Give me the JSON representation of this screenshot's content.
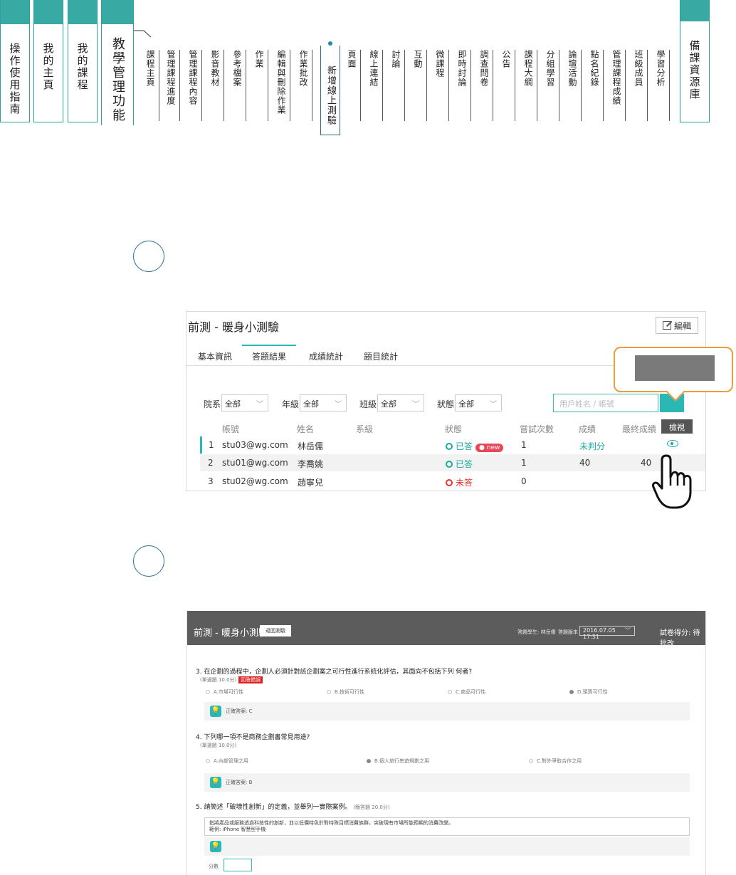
{
  "nav": {
    "main_tabs": [
      {
        "label": "操作使用指南"
      },
      {
        "label": "我的主頁"
      },
      {
        "label": "我的課程"
      },
      {
        "label": "教學管理功能"
      }
    ],
    "resource_tab": "備課資源庫",
    "function_tabs": [
      "課程主頁",
      "管理課程進度",
      "管理課程內容",
      "影音教材",
      "參考檔案",
      "作業",
      "編輯與刪除作業",
      "作業批改",
      "新增線上測驗",
      "頁面",
      "線上連結",
      "討論",
      "互動",
      "微課程",
      "即時討論",
      "調查問卷",
      "公告",
      "課程大綱",
      "分組學習",
      "論壇活動",
      "點名紀錄",
      "管理課程成績",
      "班級成員",
      "學習分析"
    ],
    "active_function": "新增線上測驗"
  },
  "panel1": {
    "title": "前測 - 暖身小測驗",
    "edit_label": "編輯",
    "tabs": [
      "基本資訊",
      "答題結果",
      "成績統計",
      "題目統計"
    ],
    "active_tab": "答題結果",
    "filters": {
      "dept_label": "院系",
      "dept_value": "全部",
      "grade_label": "年級",
      "grade_value": "全部",
      "class_label": "班級",
      "class_value": "全部",
      "status_label": "狀態",
      "status_value": "全部",
      "search_placeholder": "用戶姓名 / 帳號"
    },
    "columns": [
      "帳號",
      "姓名",
      "系級",
      "狀態",
      "嘗試次數",
      "成績",
      "最終成績",
      "檢視"
    ],
    "rows": [
      {
        "no": "1",
        "account": "stu03@wg.com",
        "name": "林岳儒",
        "status": "已答",
        "badge": "new",
        "attempts": "1",
        "score": "未判分",
        "final": ""
      },
      {
        "no": "2",
        "account": "stu01@wg.com",
        "name": "李喬姚",
        "status": "已答",
        "badge": "",
        "attempts": "1",
        "score": "40",
        "final": "40"
      },
      {
        "no": "3",
        "account": "stu02@wg.com",
        "name": "趙寧兒",
        "status": "未答",
        "badge": "",
        "attempts": "0",
        "score": "",
        "final": ""
      }
    ],
    "view_tooltip": "檢視"
  },
  "panel2": {
    "title": "前測 - 暖身小測驗",
    "back_label": "返回測驗",
    "student_label": "答題學生: 林岳儒",
    "version_label": "答題版本",
    "version_value": "2016.07.05 17:51",
    "score_label": "試卷得分: 待批改",
    "q3": {
      "text": "3.  在企劃的過程中，企劃人必須針對該企劃案之可行性進行系統化評估，其面向不包括下列 何者?",
      "meta": "(單選題 10.0分)",
      "wrong": "回答錯誤",
      "options": [
        "A.市場可行性",
        "B.技術可行性",
        "C.商品可行性",
        "D.預算可行性"
      ],
      "answer": "正確答案: C"
    },
    "q4": {
      "text": "4.  下列哪一項不是商務企劃書常見用途?",
      "meta": "(單選題 10.0分)",
      "options": [
        "A.內部管理之用",
        "B.個人旅行串遊規劃之用",
        "C.對外爭取合作之用"
      ],
      "answer": "正確答案: B"
    },
    "q5": {
      "text": "5.  請簡述「破壞性創新」的定義，並舉列一實際案例。",
      "meta": "(簡答題 20.0分)",
      "essay_line1": "指將產品或服務透過科技性的創新，並以低價特色針對特殊目標消費族群，突破現有市場所能預期的消費改變。",
      "essay_line2": "範例: iPhone 智慧型手機"
    },
    "score_input_label": "分數"
  }
}
